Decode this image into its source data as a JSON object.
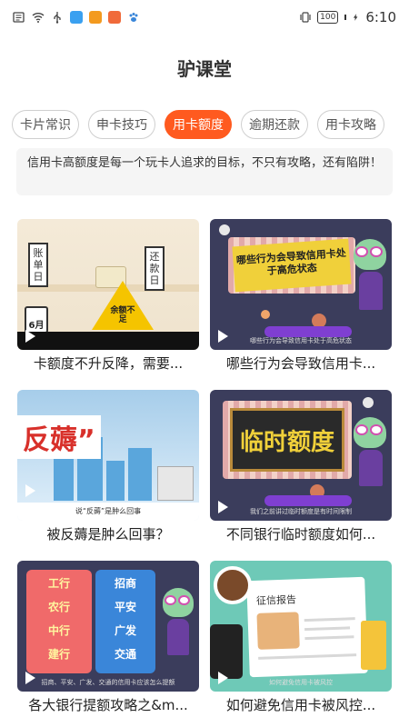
{
  "status_bar": {
    "battery": "100",
    "time": "6:10",
    "icons": [
      "notification-icon",
      "wifi-icon",
      "usb-icon",
      "app-icon-blue",
      "app-icon-orange",
      "app-icon-red",
      "paw-icon",
      "vibrate-icon",
      "charging-icon"
    ]
  },
  "header": {
    "title": "驴课堂"
  },
  "tabs": [
    {
      "label": "卡片常识",
      "active": false
    },
    {
      "label": "申卡技巧",
      "active": false
    },
    {
      "label": "用卡额度",
      "active": true
    },
    {
      "label": "逾期还款",
      "active": false
    },
    {
      "label": "用卡攻略",
      "active": false
    }
  ],
  "description": "信用卡高额度是每一个玩卡人追求的目标，不只有攻略，还有陷阱！",
  "videos": [
    {
      "title": "卡额度不升反降，需要...",
      "thumb": {
        "sign_left": "账单日",
        "sign_right": "还款日",
        "warning": "余额不足",
        "calendar": "6月"
      }
    },
    {
      "title": "哪些行为会导致信用卡...",
      "thumb": {
        "banner": "哪些行为会导致信用卡处于高危状态",
        "subtitle": "哪些行为会导致信用卡处于高危状态"
      }
    },
    {
      "title": "被反薅是肿么回事？",
      "thumb": {
        "headline": "反薅”",
        "bottom": "说“反薅”是肿么回事"
      }
    },
    {
      "title": "不同银行临时额度如何...",
      "thumb": {
        "panel": "临时额度",
        "subtitle": "我们之前讲过临时额度是有时间限制"
      }
    },
    {
      "title": "各大银行提额攻略之&m...",
      "thumb": {
        "left_list": [
          "工行",
          "农行",
          "中行",
          "建行"
        ],
        "right_list": [
          "招商",
          "平安",
          "广发",
          "交通"
        ],
        "subtitle": "招商、平安、广发、交通的信用卡应该怎么提额"
      }
    },
    {
      "title": "如何避免信用卡被风控...",
      "thumb": {
        "report": "征信报告",
        "subtitle": "如何避免信用卡被风控"
      }
    }
  ],
  "colors": {
    "accent": "#ff5a1f",
    "tab_border": "#cfcfcf",
    "desc_bg": "#f5f5f5"
  }
}
